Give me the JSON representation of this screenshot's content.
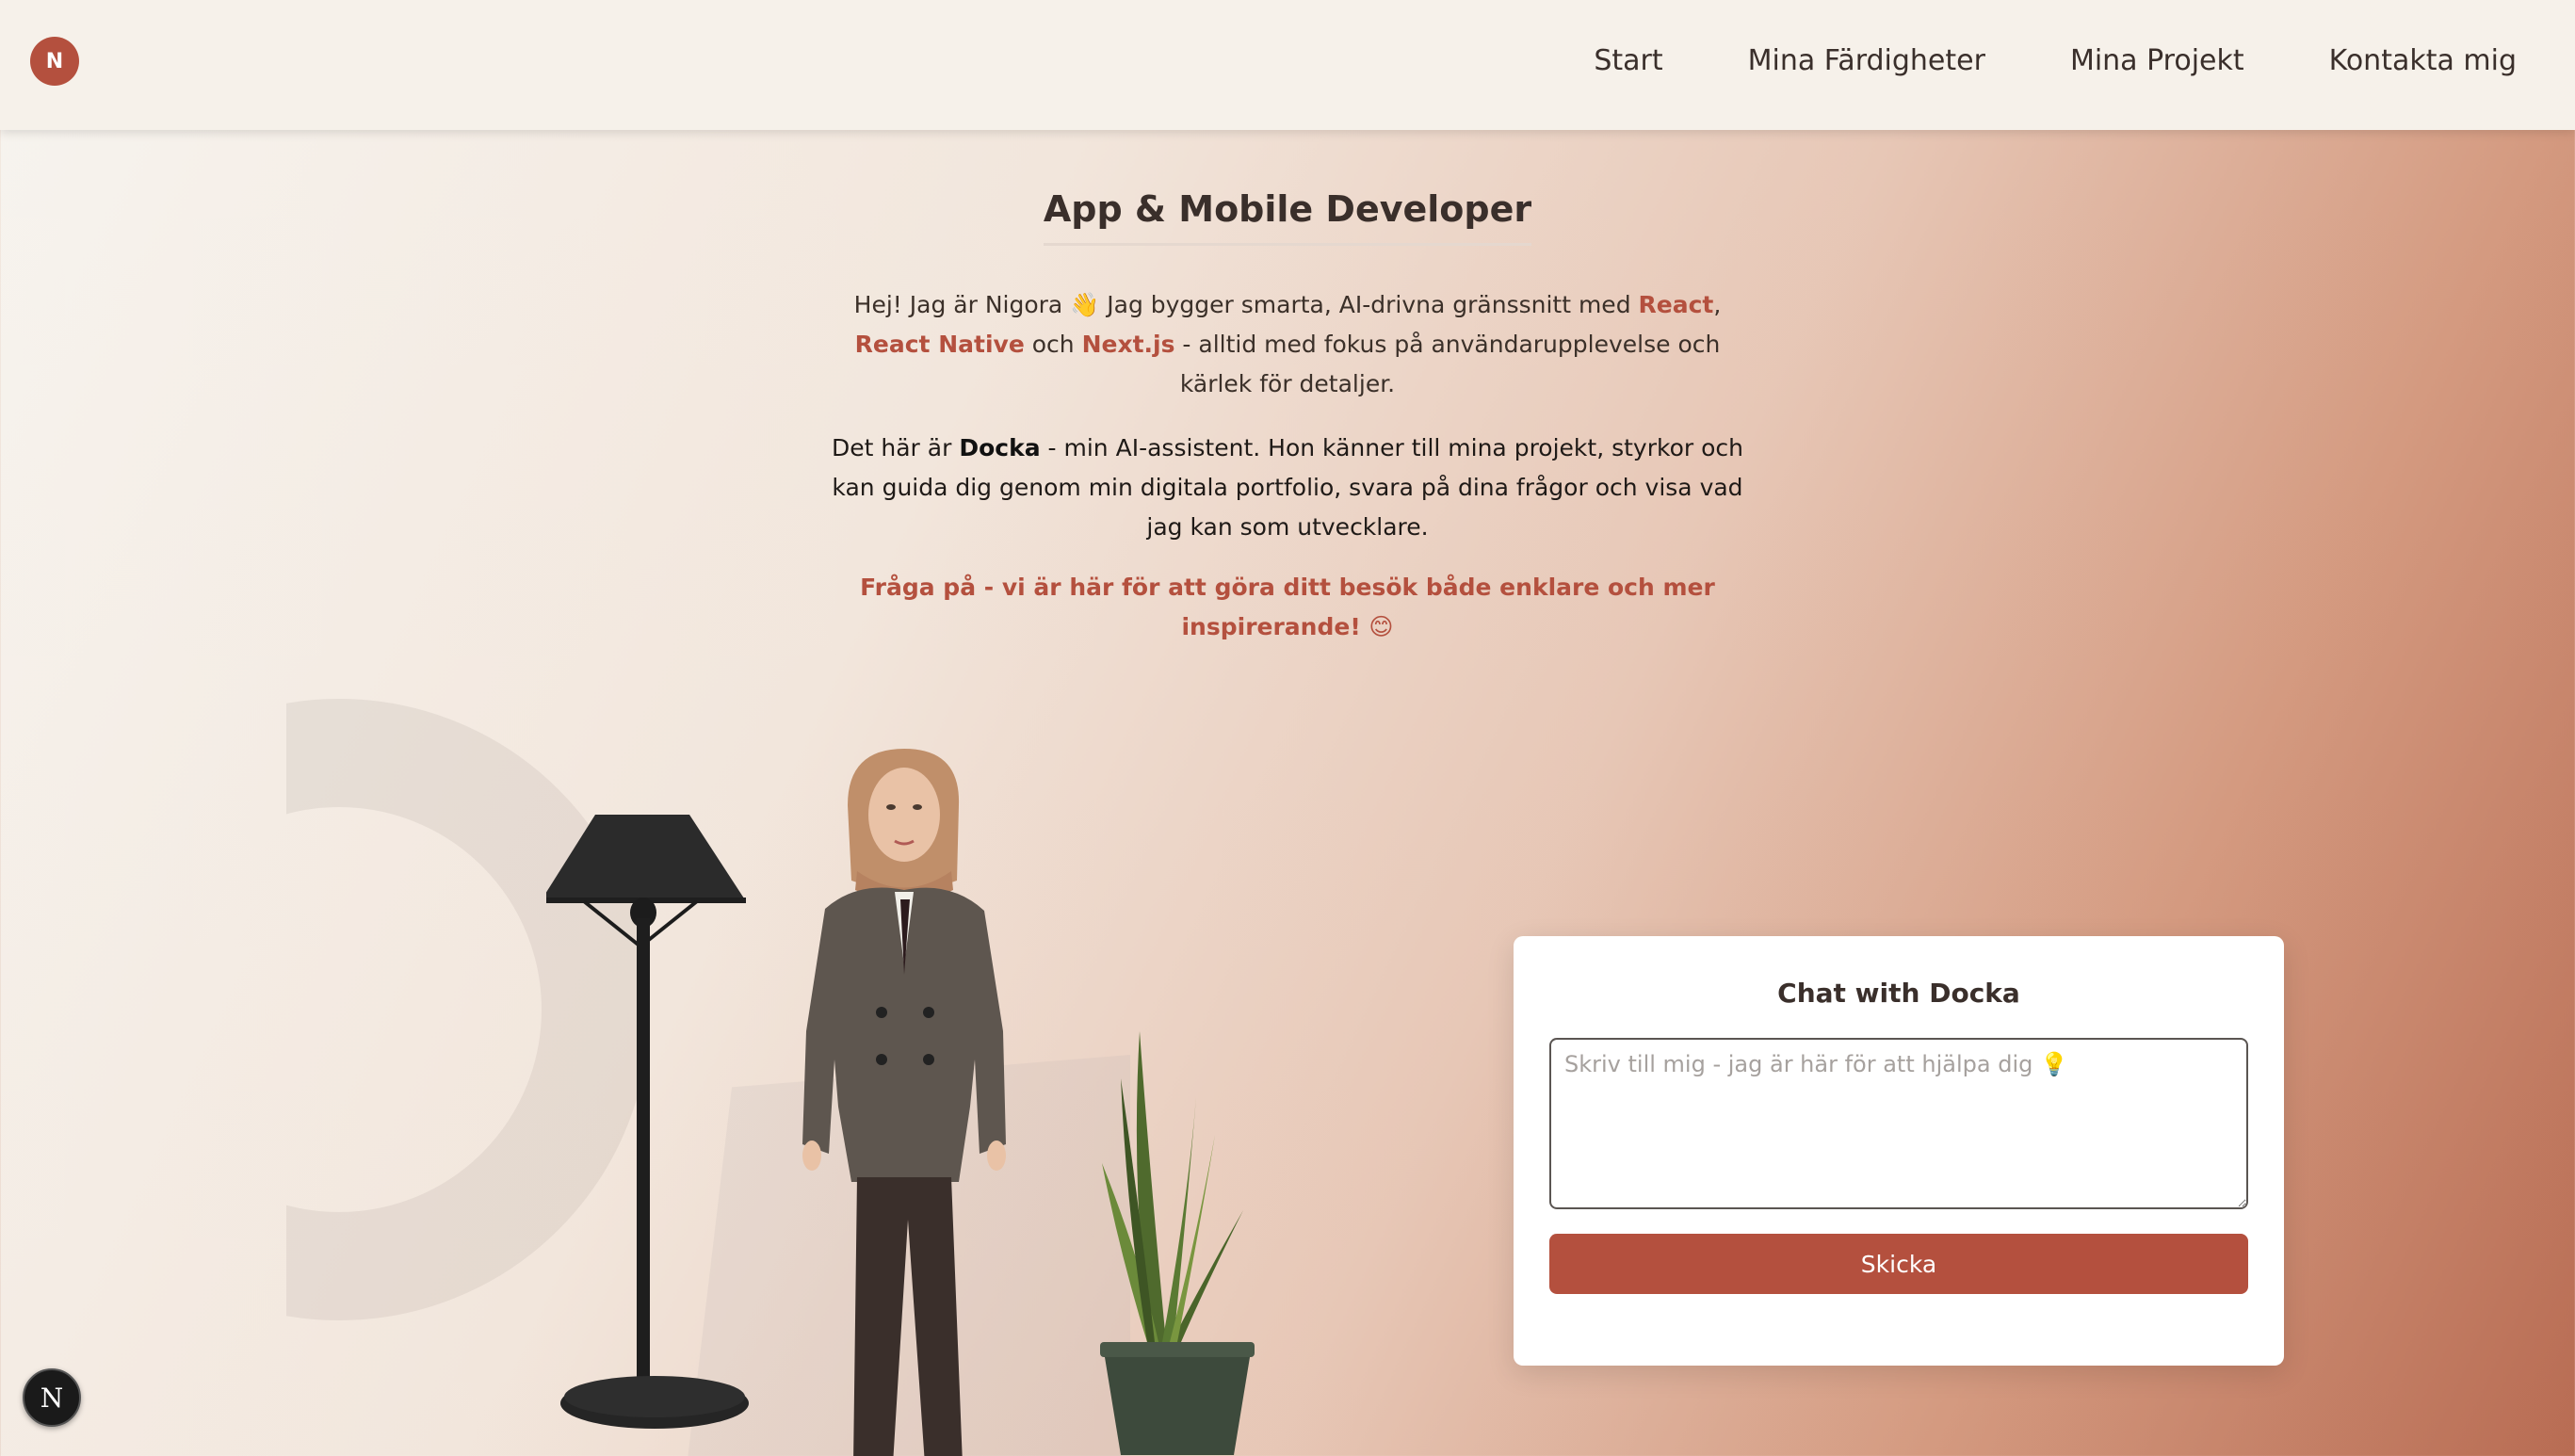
{
  "brand": {
    "logo_letter": "N"
  },
  "nav": [
    "Start",
    "Mina Färdigheter",
    "Mina Projekt",
    "Kontakta mig"
  ],
  "hero": {
    "title": "App & Mobile Developer",
    "intro_start": "Hej! Jag är Nigora 👋 Jag bygger smarta, AI-drivna gränssnitt med ",
    "react": "React",
    "comma": ", ",
    "react_native": "React Native",
    "och": " och ",
    "nextjs": "Next.js",
    "intro_end": " - alltid med fokus på användarupplevelse och kärlek för detaljer.",
    "docka_start": "Det här är ",
    "docka": "Docka",
    "docka_end": " - min AI-assistent. Hon känner till mina projekt, styrkor och kan guida dig genom min digitala portfolio, svara på dina frågor och visa vad jag kan som utvecklare.",
    "cta": "Fråga på - vi är här för att göra ditt besök både enklare och mer inspirerande! 😊"
  },
  "chat": {
    "title": "Chat with Docka",
    "placeholder": "Skriv till mig - jag är här för att hjälpa dig 💡",
    "send_label": "Skicka"
  },
  "dev_badge": {
    "letter": "N"
  },
  "colors": {
    "accent": "#b4503e",
    "nav_bg": "#f6f1ea"
  }
}
